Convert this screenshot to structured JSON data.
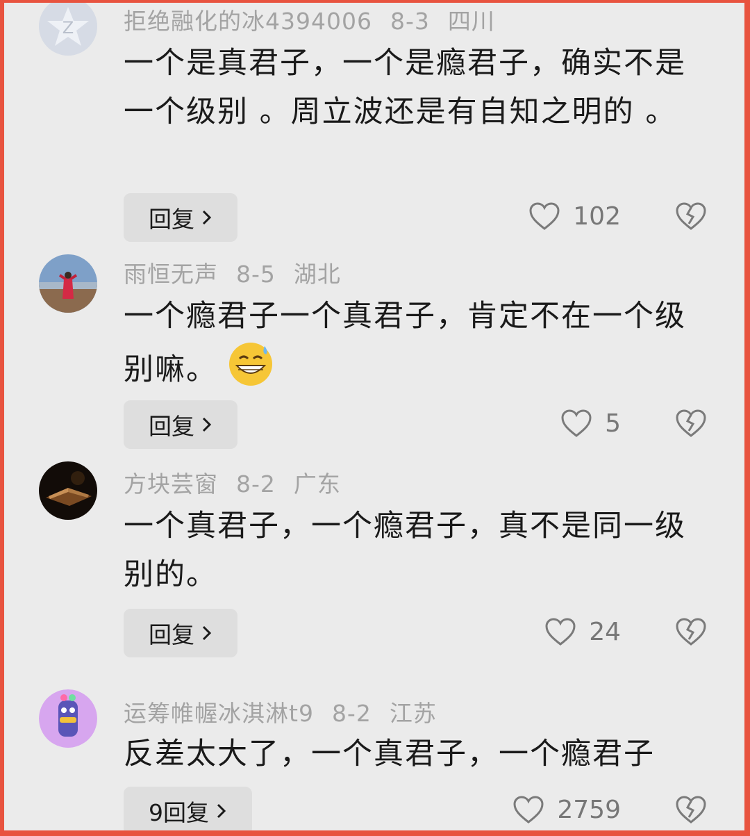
{
  "comments": [
    {
      "username": "拒绝融化的冰4394006",
      "date": "8-3",
      "location": "四川",
      "text": "一个是真君子，一个是瘾君子，确实不是一个级别 。周立波还是有自知之明的 。",
      "reply_label": "回复",
      "likes": "102"
    },
    {
      "username": "雨恒无声",
      "date": "8-5",
      "location": "湖北",
      "text": "一个瘾君子一个真君子，肯定不在一个级别嘛。",
      "reply_label": "回复",
      "likes": "5"
    },
    {
      "username": "方块芸窗",
      "date": "8-2",
      "location": "广东",
      "text": "一个真君子，一个瘾君子，真不是同一级别的。",
      "reply_label": "回复",
      "likes": "24"
    },
    {
      "username": "运筹帷幄冰淇淋t9",
      "date": "8-2",
      "location": "江苏",
      "text": "反差太大了，一个真君子，一个瘾君子",
      "reply_label": "9回复",
      "likes": "2759"
    }
  ],
  "icons": {
    "like": "heart-outline-icon",
    "dislike": "broken-heart-icon",
    "chevron": "chevron-right-icon"
  },
  "colors": {
    "border": "#e8533f",
    "background": "#ebebeb",
    "meta_text": "#a3a3a3"
  }
}
